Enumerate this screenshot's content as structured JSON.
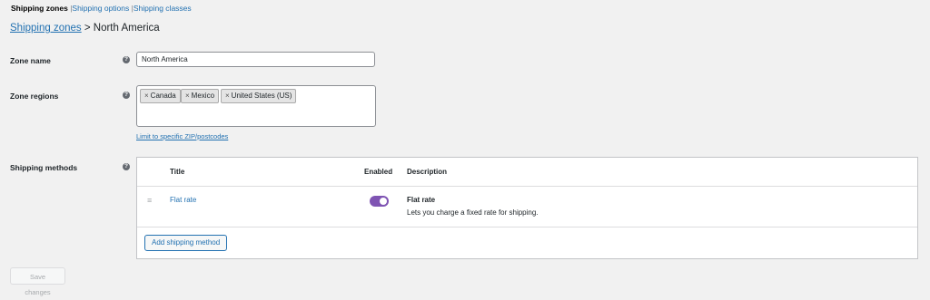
{
  "subnav": {
    "current": "Shipping zones",
    "separator": "|",
    "options": "Shipping options",
    "classes": "Shipping classes"
  },
  "heading": {
    "breadcrumb_link": "Shipping zones",
    "separator": ">",
    "zone": "North America"
  },
  "zone_name": {
    "label": "Zone name",
    "value": "North America"
  },
  "zone_regions": {
    "label": "Zone regions",
    "tags": [
      "Canada",
      "Mexico",
      "United States (US)"
    ],
    "limit_link": "Limit to specific ZIP/postcodes"
  },
  "shipping_methods": {
    "label": "Shipping methods",
    "headers": {
      "title": "Title",
      "enabled": "Enabled",
      "description": "Description"
    },
    "row": {
      "title": "Flat rate",
      "enabled": true,
      "desc_title": "Flat rate",
      "desc_text": "Lets you charge a fixed rate for shipping."
    },
    "add_button": "Add shipping method"
  },
  "save_button": "Save changes",
  "help_glyph": "?",
  "remove_glyph": "×",
  "handle_glyph": "≡",
  "colors": {
    "accent": "#7f54b3",
    "link": "#2271b1"
  }
}
